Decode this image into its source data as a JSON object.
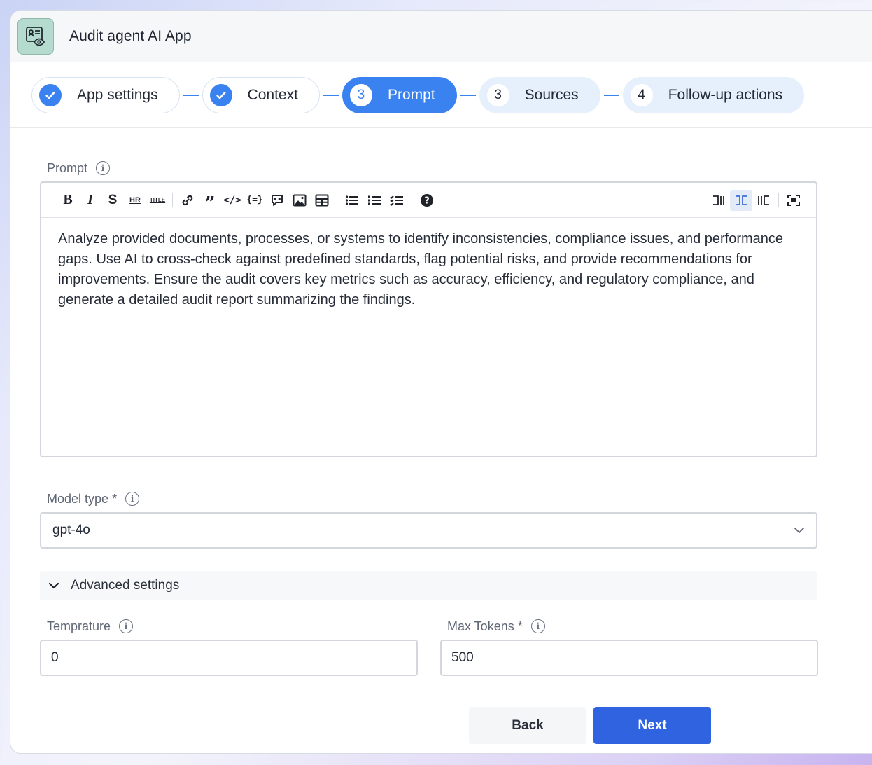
{
  "app": {
    "title": "Audit agent AI App",
    "icon": "audit-eye-icon"
  },
  "stepper": {
    "steps": [
      {
        "label": "App settings",
        "state": "done",
        "marker": ""
      },
      {
        "label": "Context",
        "state": "done",
        "marker": ""
      },
      {
        "label": "Prompt",
        "state": "active",
        "marker": "3"
      },
      {
        "label": "Sources",
        "state": "pending",
        "marker": "3"
      },
      {
        "label": "Follow-up actions",
        "state": "pending",
        "marker": "4"
      }
    ]
  },
  "prompt": {
    "label": "Prompt",
    "toolbar": {
      "left": [
        "B",
        "I",
        "S",
        "HR",
        "TITLE",
        "link",
        "quote",
        "code",
        "code-block",
        "comment",
        "image",
        "table",
        "bullet-list",
        "ordered-list",
        "task-list",
        "help"
      ],
      "right": [
        "layout-left",
        "layout-center",
        "layout-right",
        "fullscreen"
      ],
      "selected": "layout-center"
    },
    "text": "Analyze provided documents, processes, or systems to identify inconsistencies, compliance issues, and performance gaps. Use AI to cross-check against predefined standards, flag potential risks, and provide recommendations for improvements. Ensure the audit covers key metrics such as accuracy, efficiency, and regulatory compliance, and generate a detailed audit report summarizing the findings."
  },
  "model_type": {
    "label": "Model type",
    "required_mark": "*",
    "value": "gpt-4o"
  },
  "advanced": {
    "label": "Advanced settings"
  },
  "temperature": {
    "label": "Temprature",
    "value": "0"
  },
  "max_tokens": {
    "label": "Max Tokens",
    "required_mark": "*",
    "value": "500"
  },
  "actions": {
    "back_label": "Back",
    "next_label": "Next"
  },
  "colors": {
    "accent": "#3a82ef",
    "primary_button": "#2f63e0",
    "app_icon_bg": "#b5dbcf"
  }
}
